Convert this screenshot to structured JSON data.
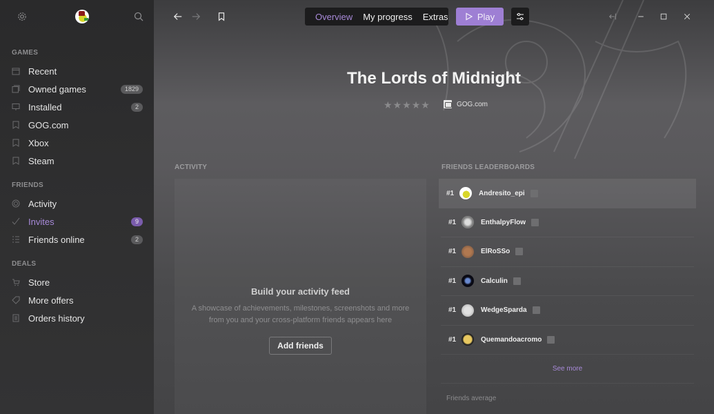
{
  "sidebar": {
    "sections": [
      {
        "title": "GAMES",
        "items": [
          {
            "label": "Recent",
            "icon": "calendar-icon",
            "badge": null
          },
          {
            "label": "Owned games",
            "icon": "stack-icon",
            "badge": "1829"
          },
          {
            "label": "Installed",
            "icon": "monitor-icon",
            "badge": "2"
          },
          {
            "label": "GOG.com",
            "icon": "bookmark-icon",
            "badge": null
          },
          {
            "label": "Xbox",
            "icon": "bookmark-icon",
            "badge": null
          },
          {
            "label": "Steam",
            "icon": "bookmark-icon",
            "badge": null
          }
        ]
      },
      {
        "title": "FRIENDS",
        "items": [
          {
            "label": "Activity",
            "icon": "target-icon",
            "badge": null
          },
          {
            "label": "Invites",
            "icon": "check-icon",
            "badge": "9",
            "active": true
          },
          {
            "label": "Friends online",
            "icon": "list-icon",
            "badge": "2"
          }
        ]
      },
      {
        "title": "DEALS",
        "items": [
          {
            "label": "Store",
            "icon": "cart-icon",
            "badge": null
          },
          {
            "label": "More offers",
            "icon": "tag-icon",
            "badge": null
          },
          {
            "label": "Orders history",
            "icon": "receipt-icon",
            "badge": null
          }
        ]
      }
    ]
  },
  "topbar": {
    "tabs": [
      {
        "label": "Overview",
        "active": true
      },
      {
        "label": "My progress"
      },
      {
        "label": "Extras"
      }
    ],
    "play_label": "Play"
  },
  "game": {
    "title": "The Lords of Midnight",
    "rating_stars": 0,
    "rating_max": 5,
    "platform": "GOG.com"
  },
  "activity": {
    "section_title": "ACTIVITY",
    "empty_title": "Build your activity feed",
    "empty_desc": "A showcase of achievements, milestones, screenshots and more from you and your cross-platform friends appears here",
    "add_friends_label": "Add friends"
  },
  "leaderboard": {
    "section_title": "FRIENDS LEADERBOARDS",
    "rows": [
      {
        "rank": "#1",
        "name": "Andresito_epi"
      },
      {
        "rank": "#1",
        "name": "EnthalpyFlow"
      },
      {
        "rank": "#1",
        "name": "ElRoSSo"
      },
      {
        "rank": "#1",
        "name": "Calculin"
      },
      {
        "rank": "#1",
        "name": "WedgeSparda"
      },
      {
        "rank": "#1",
        "name": "Quemandoacromo"
      }
    ],
    "see_more_label": "See more",
    "friends_average_label": "Friends average"
  },
  "colors": {
    "accent": "#a88ad9",
    "play_button": "#9e7fd4",
    "sidebar_bg": "#2d2d2e"
  }
}
